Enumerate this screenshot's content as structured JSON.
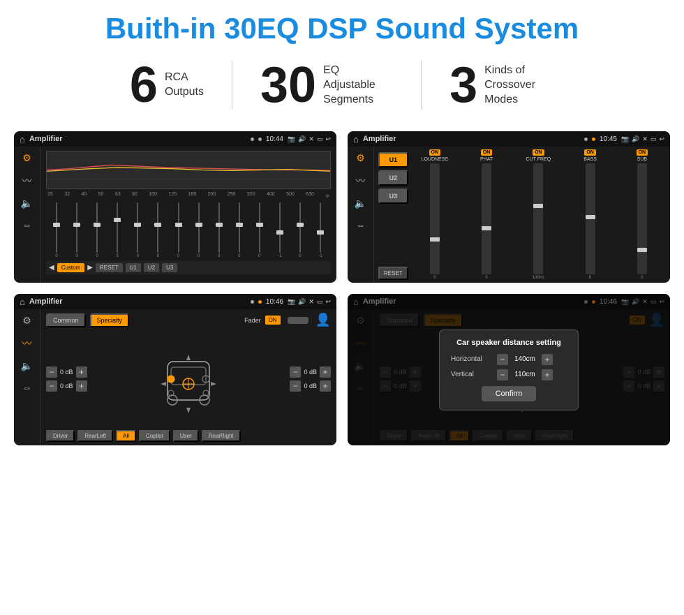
{
  "header": {
    "title": "Buith-in 30EQ DSP Sound System"
  },
  "stats": [
    {
      "number": "6",
      "label": "RCA\nOutputs"
    },
    {
      "number": "30",
      "label": "EQ Adjustable\nSegments"
    },
    {
      "number": "3",
      "label": "Kinds of\nCrossover Modes"
    }
  ],
  "screens": [
    {
      "id": "eq-screen",
      "statusBar": {
        "title": "Amplifier",
        "time": "10:44",
        "dots": 2
      },
      "type": "eq"
    },
    {
      "id": "crossover-screen",
      "statusBar": {
        "title": "Amplifier",
        "time": "10:45",
        "dots": 2
      },
      "type": "crossover"
    },
    {
      "id": "fader-screen",
      "statusBar": {
        "title": "Amplifier",
        "time": "10:46",
        "dots": 2
      },
      "type": "fader"
    },
    {
      "id": "dialog-screen",
      "statusBar": {
        "title": "Amplifier",
        "time": "10:46",
        "dots": 2
      },
      "type": "dialog"
    }
  ],
  "eq": {
    "freqLabels": [
      "25",
      "32",
      "40",
      "50",
      "63",
      "80",
      "100",
      "125",
      "160",
      "200",
      "250",
      "320",
      "400",
      "500",
      "630"
    ],
    "values": [
      "0",
      "0",
      "0",
      "5",
      "0",
      "0",
      "0",
      "0",
      "0",
      "0",
      "0",
      "-1",
      "0",
      "-1"
    ],
    "buttons": [
      "Custom",
      "RESET",
      "U1",
      "U2",
      "U3"
    ],
    "graphColors": {
      "line1": "#e05050",
      "line2": "#f0c030",
      "grid": "#3a3a3a"
    }
  },
  "crossover": {
    "presets": [
      "U1",
      "U2",
      "U3"
    ],
    "channels": [
      "LOUDNESS",
      "PHAT",
      "CUT FREQ",
      "BASS",
      "SUB"
    ],
    "channelStatus": [
      "ON",
      "ON",
      "ON",
      "ON",
      "ON"
    ],
    "resetLabel": "RESET"
  },
  "fader": {
    "tabs": [
      "Common",
      "Specialty"
    ],
    "faderLabel": "Fader",
    "onLabel": "ON",
    "dbValues": [
      "0 dB",
      "0 dB",
      "0 dB",
      "0 dB"
    ],
    "buttons": [
      "Driver",
      "RearLeft",
      "All",
      "Copilot",
      "RearRight",
      "User"
    ]
  },
  "dialog": {
    "title": "Car speaker distance setting",
    "horizontalLabel": "Horizontal",
    "horizontalValue": "140cm",
    "verticalLabel": "Vertical",
    "verticalValue": "110cm",
    "confirmLabel": "Confirm",
    "dbValues": [
      "0 dB",
      "0 dB"
    ],
    "buttons": [
      "Driver",
      "RearLeft",
      "All",
      "Copilot",
      "RearRight",
      "User"
    ]
  }
}
